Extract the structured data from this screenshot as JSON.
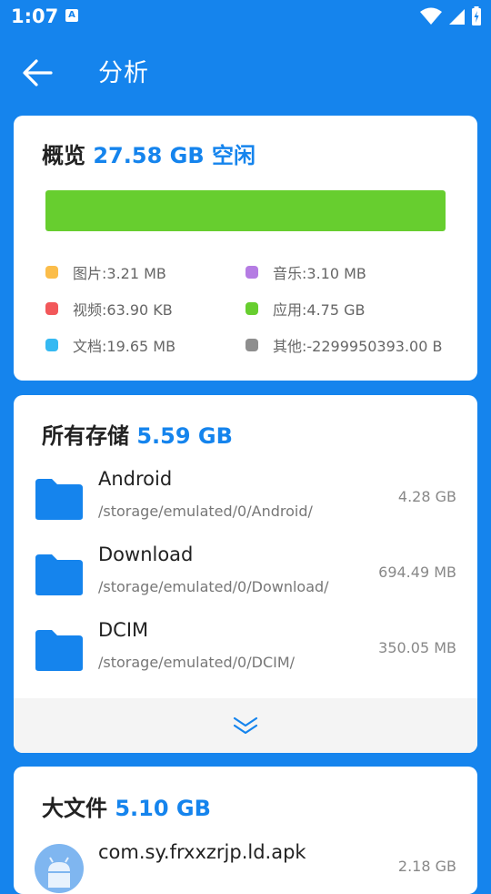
{
  "status": {
    "time": "1:07",
    "notification_glyph": "A"
  },
  "appbar": {
    "title": "分析"
  },
  "overview": {
    "title": "概览",
    "free": "27.58 GB 空闲",
    "bar_color": "#67CE2F",
    "bar_fill_fraction": 1.0,
    "legend": [
      {
        "label": "图片:3.21 MB",
        "color": "#FBBD4A"
      },
      {
        "label": "音乐:3.10 MB",
        "color": "#B57CE3"
      },
      {
        "label": "视频:63.90 KB",
        "color": "#F2585A"
      },
      {
        "label": "应用:4.75 GB",
        "color": "#67CE2F"
      },
      {
        "label": "文档:19.65 MB",
        "color": "#35B9F2"
      },
      {
        "label": "其他:-2299950393.00 B",
        "color": "#8E8E8E"
      }
    ]
  },
  "storage": {
    "title": "所有存储",
    "total": "5.59 GB",
    "folders": [
      {
        "name": "Android",
        "path": "/storage/emulated/0/Android/",
        "size": "4.28 GB"
      },
      {
        "name": "Download",
        "path": "/storage/emulated/0/Download/",
        "size": "694.49 MB"
      },
      {
        "name": "DCIM",
        "path": "/storage/emulated/0/DCIM/",
        "size": "350.05 MB"
      }
    ]
  },
  "large_files": {
    "title": "大文件",
    "total": "5.10 GB",
    "files": [
      {
        "name": "com.sy.frxxzrjp.ld.apk",
        "size": "2.18 GB"
      }
    ]
  },
  "colors": {
    "accent": "#1584ED",
    "folder": "#1584ED"
  },
  "icons": {
    "status": [
      "notification-a-icon",
      "wifi-icon",
      "cellular-signal-icon",
      "battery-icon"
    ],
    "back": "arrow-left-icon",
    "folder": "folder-icon",
    "expand": "double-chevron-down-icon",
    "apk": "android-icon"
  }
}
